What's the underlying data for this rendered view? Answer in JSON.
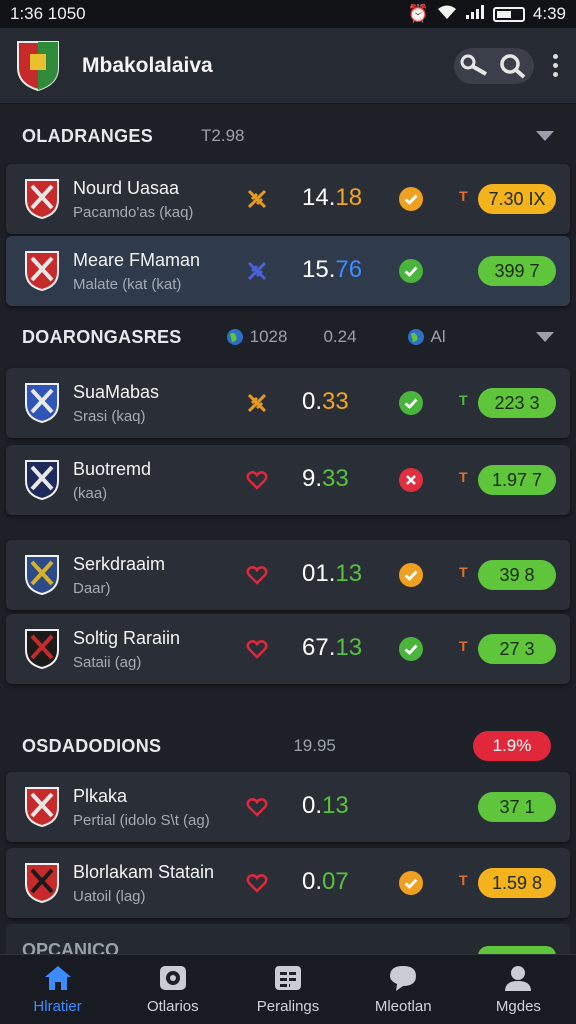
{
  "status_bar": {
    "time": "1:36 1050",
    "battery": "4:39"
  },
  "app": {
    "title": "Mbakolalaiva"
  },
  "sections": [
    {
      "title": "OLADRANGES",
      "meta": "T2.98"
    },
    {
      "title": "DOARONGASRES",
      "meta1": "1028",
      "meta2": "0.24",
      "meta3": "Al"
    },
    {
      "title": "OSDADODIONS",
      "meta": "19.95",
      "badge": "1.9%"
    }
  ],
  "matches": [
    {
      "name": "Nourd Uasaa",
      "sub": "Pacamdo'as (kaq)",
      "score_a": "14.",
      "score_b": "18",
      "odds": "7.30  IX",
      "trend": "T"
    },
    {
      "name": "Meare FMaman",
      "sub": "Malate (kat (kat)",
      "score_a": "15.",
      "score_b": "76",
      "odds": "399  7",
      "trend": ""
    },
    {
      "name": "SuaMabas",
      "sub": "Srasi (kaq)",
      "score_a": "0.",
      "score_b": "33",
      "odds": "223  3",
      "trend": "T"
    },
    {
      "name": "Buotremd",
      "sub": "(kaa)",
      "score_a": "9.",
      "score_b": "33",
      "odds": "1.97  7",
      "trend": "T"
    },
    {
      "name": "Serkdraaim",
      "sub": "Daar)",
      "score_a": "01.",
      "score_b": "13",
      "odds": "39  8",
      "trend": "T"
    },
    {
      "name": "Soltig Raraiin",
      "sub": "Sataii (ag)",
      "score_a": "67.",
      "score_b": "13",
      "odds": "27  3",
      "trend": "T"
    },
    {
      "name": "Plkaka",
      "sub": "Pertial (idolo  S\\t (ag)",
      "score_a": "0.",
      "score_b": "13",
      "odds": "37  1",
      "trend": ""
    },
    {
      "name": "Blorlakam Statain",
      "sub": "Uatoil (lag)",
      "score_a": "0.",
      "score_b": "07",
      "odds": "1.59  8",
      "trend": "T"
    }
  ],
  "footer_partial": "OPCANICO",
  "nav": [
    {
      "label": "Hlratier",
      "icon": "home-icon"
    },
    {
      "label": "Otlarios",
      "icon": "camera-icon"
    },
    {
      "label": "Peralings",
      "icon": "list-icon"
    },
    {
      "label": "Mleotlan",
      "icon": "chat-icon"
    },
    {
      "label": "Mgdes",
      "icon": "profile-icon"
    }
  ],
  "colors": {
    "accent_blue": "#3c8cff",
    "odds_yellow": "#f4b21c",
    "odds_green": "#5fc53b",
    "badge_red": "#e0283a",
    "status_orange": "#f0a020",
    "status_green": "#49b53a",
    "status_red": "#e03040"
  }
}
